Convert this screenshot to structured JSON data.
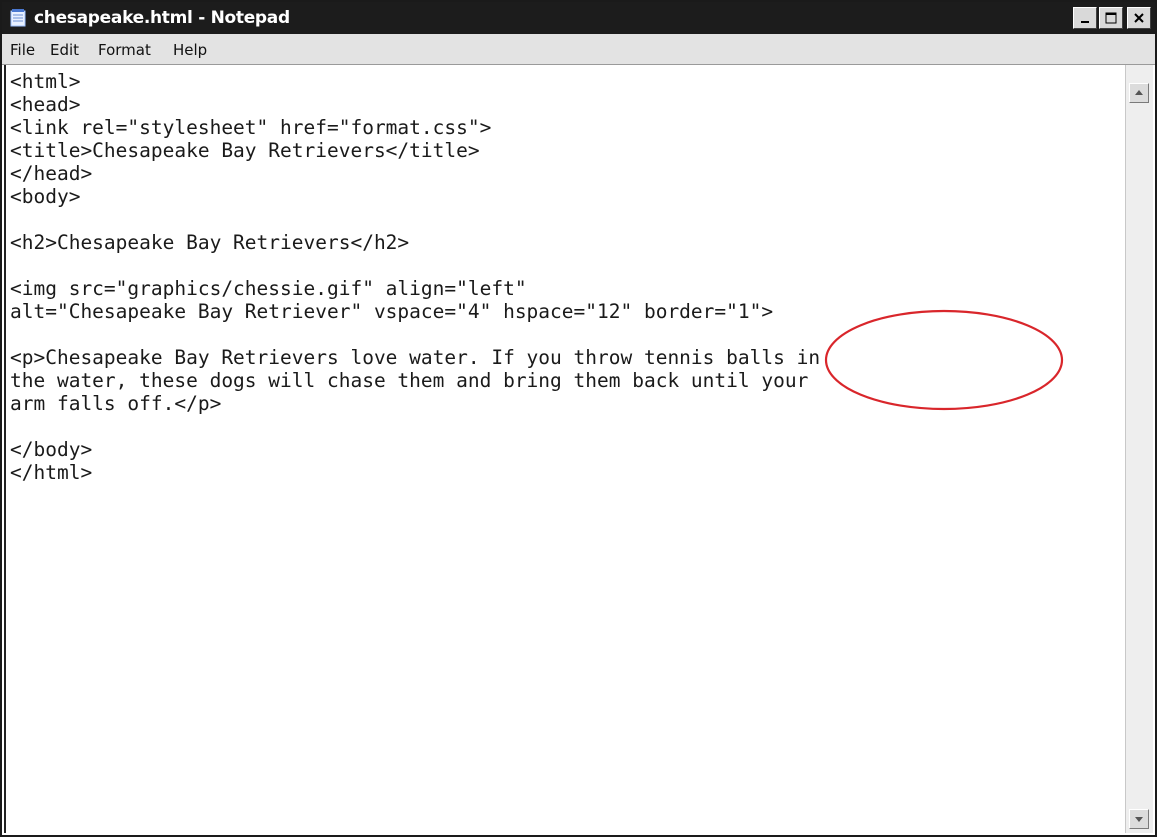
{
  "window": {
    "title": "chesapeake.html - Notepad",
    "icon": "notepad-icon"
  },
  "title_buttons": {
    "minimize_icon": "minimize-icon",
    "maximize_icon": "maximize-icon",
    "close_icon": "close-icon"
  },
  "menu": {
    "file": "File",
    "edit": "Edit",
    "format": "Format",
    "help": "Help"
  },
  "editor": {
    "lines": [
      "<html>",
      "<head>",
      "<link rel=\"stylesheet\" href=\"format.css\">",
      "<title>Chesapeake Bay Retrievers</title>",
      "</head>",
      "<body>",
      "",
      "<h2>Chesapeake Bay Retrievers</h2>",
      "",
      "<img src=\"graphics/chessie.gif\" align=\"left\"",
      "alt=\"Chesapeake Bay Retriever\" vspace=\"4\" hspace=\"12\" border=\"1\">",
      "",
      "<p>Chesapeake Bay Retrievers love water. If you throw tennis balls in",
      "the water, these dogs will chase them and bring them back until your",
      "arm falls off.</p>",
      "",
      "</body>",
      "</html>"
    ]
  },
  "annotation": {
    "color": "#d9262b",
    "highlighted_text": "border=\"1\">"
  },
  "colors": {
    "titlebar": "#1c1c1c",
    "menubar": "#e3e3e3",
    "annotation": "#d9262b"
  }
}
